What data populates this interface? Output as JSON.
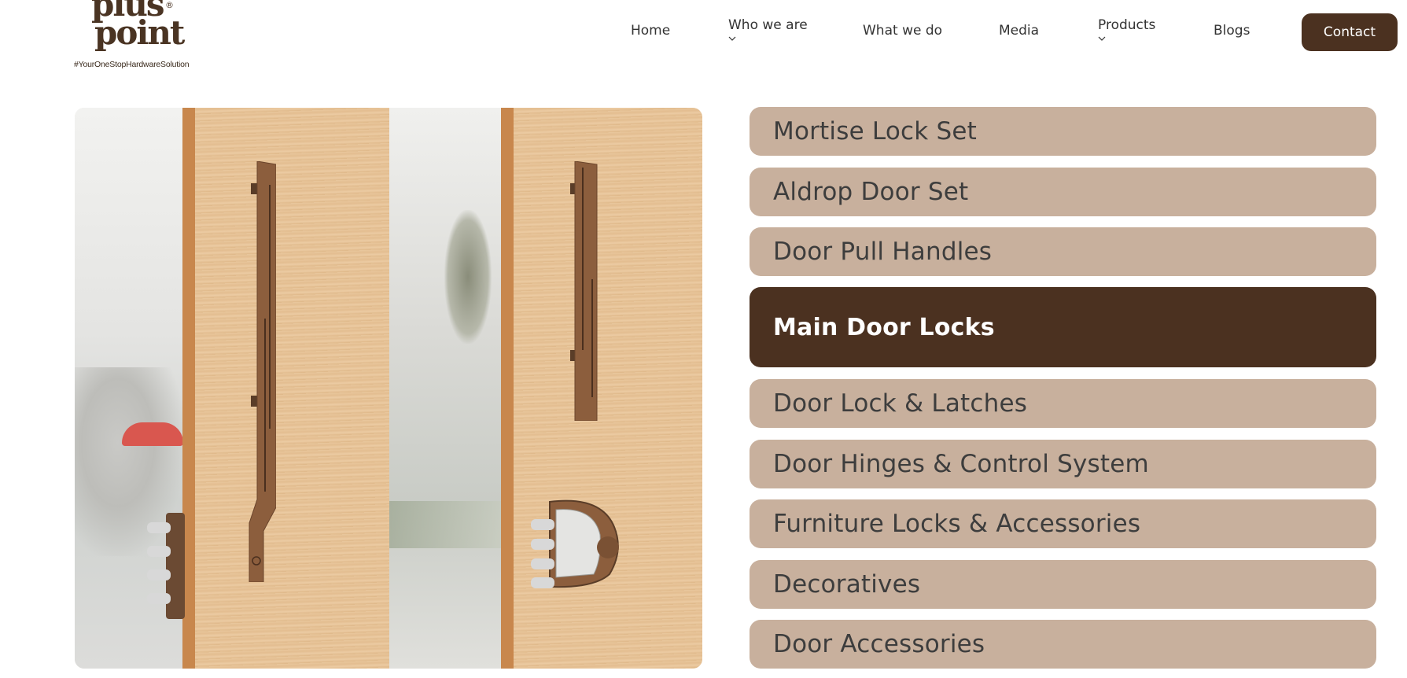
{
  "brand": {
    "logo_line1": "plus",
    "logo_line2": "point",
    "registered": "®",
    "tagline": "#YourOneStopHardwareSolution"
  },
  "nav": {
    "home": "Home",
    "who_we_are": "Who we are",
    "what_we_do": "What we do",
    "media": "Media",
    "products": "Products",
    "blogs": "Blogs",
    "contact": "Contact"
  },
  "colors": {
    "brand_dark": "#4b3120",
    "category_bg": "#c8b09d",
    "active_text": "#ffffff"
  },
  "categories": [
    {
      "label": "Mortise Lock Set",
      "active": false
    },
    {
      "label": "Aldrop Door Set",
      "active": false
    },
    {
      "label": "Door Pull Handles",
      "active": false
    },
    {
      "label": "Main Door Locks",
      "active": true
    },
    {
      "label": "Door Lock & Latches",
      "active": false
    },
    {
      "label": "Door Hinges & Control System",
      "active": false
    },
    {
      "label": "Furniture Locks & Accessories",
      "active": false
    },
    {
      "label": "Decoratives",
      "active": false
    },
    {
      "label": "Door Accessories",
      "active": false
    }
  ]
}
